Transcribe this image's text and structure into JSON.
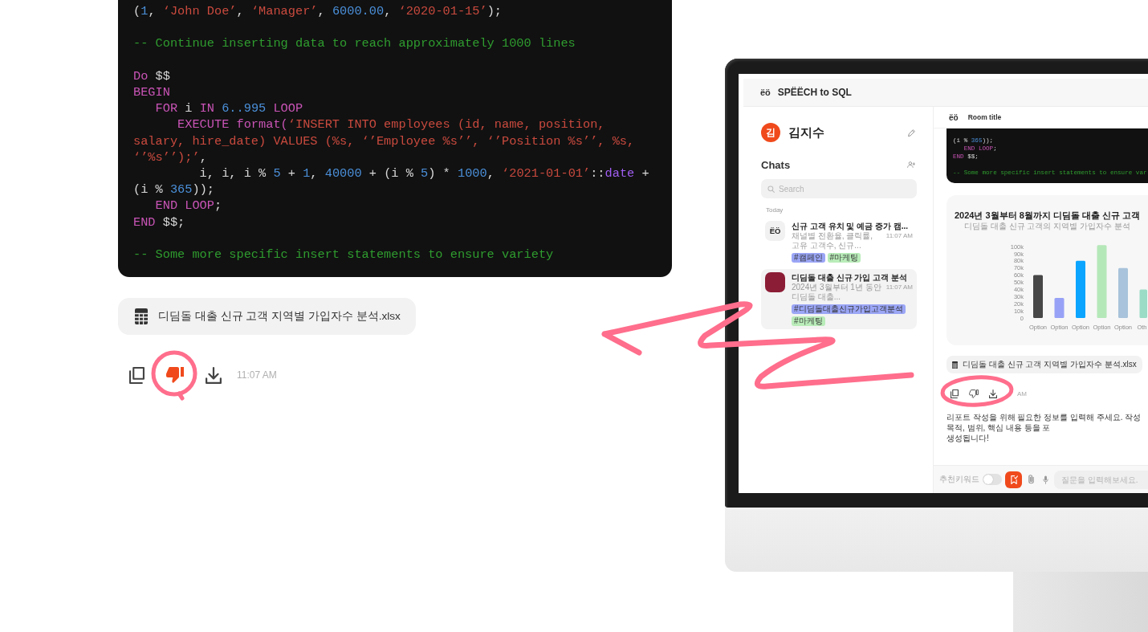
{
  "chat_response": {
    "code_lines": [
      {
        "kind": "code",
        "tokens": [
          {
            "kind": "plain",
            "text": "("
          },
          {
            "kind": "number",
            "text": "1"
          },
          {
            "kind": "plain",
            "text": ", "
          },
          {
            "kind": "string",
            "text": "‘John Doe’"
          },
          {
            "kind": "plain",
            "text": ", "
          },
          {
            "kind": "string",
            "text": "‘Manager’"
          },
          {
            "kind": "plain",
            "text": ", "
          },
          {
            "kind": "number",
            "text": "6000.00"
          },
          {
            "kind": "plain",
            "text": ", "
          },
          {
            "kind": "string",
            "text": "‘2020-01-15’"
          },
          {
            "kind": "plain",
            "text": ");"
          }
        ]
      },
      {
        "kind": "blank"
      },
      {
        "kind": "code",
        "tokens": [
          {
            "kind": "comment",
            "text": "-- Continue inserting data to reach approximately 1000 lines"
          }
        ]
      },
      {
        "kind": "blank"
      },
      {
        "kind": "code",
        "tokens": [
          {
            "kind": "keyword",
            "text": "Do"
          },
          {
            "kind": "plain",
            "text": " $$"
          }
        ]
      },
      {
        "kind": "code",
        "tokens": [
          {
            "kind": "keyword",
            "text": "BEGIN"
          }
        ]
      },
      {
        "kind": "code",
        "tokens": [
          {
            "kind": "keyword",
            "text": "   FOR"
          },
          {
            "kind": "plain",
            "text": " i "
          },
          {
            "kind": "keyword",
            "text": "IN"
          },
          {
            "kind": "number",
            "text": " 6..995"
          },
          {
            "kind": "keyword",
            "text": " LOOP"
          }
        ]
      },
      {
        "kind": "code",
        "tokens": [
          {
            "kind": "keyword",
            "text": "      EXECUTE format("
          },
          {
            "kind": "string",
            "text": "‘INSERT INTO employees (id, name, position,"
          }
        ]
      },
      {
        "kind": "code",
        "tokens": [
          {
            "kind": "string",
            "text": "salary, hire_date) VALUES (%s, ‘’Employee %s’’, ‘’Position %s’’, %s,"
          }
        ]
      },
      {
        "kind": "code",
        "tokens": [
          {
            "kind": "string",
            "text": "‘’%s’’);’"
          },
          {
            "kind": "plain",
            "text": ","
          }
        ]
      },
      {
        "kind": "code",
        "tokens": [
          {
            "kind": "plain",
            "text": "         i, i, i % "
          },
          {
            "kind": "number",
            "text": "5"
          },
          {
            "kind": "plain",
            "text": " + "
          },
          {
            "kind": "number",
            "text": "1"
          },
          {
            "kind": "plain",
            "text": ", "
          },
          {
            "kind": "number",
            "text": "40000"
          },
          {
            "kind": "plain",
            "text": " + (i % "
          },
          {
            "kind": "number",
            "text": "5"
          },
          {
            "kind": "plain",
            "text": ") * "
          },
          {
            "kind": "number",
            "text": "1000"
          },
          {
            "kind": "plain",
            "text": ", "
          },
          {
            "kind": "string",
            "text": "‘2021-01-01’"
          },
          {
            "kind": "plain",
            "text": "::"
          },
          {
            "kind": "type",
            "text": "date"
          },
          {
            "kind": "plain",
            "text": " +"
          }
        ]
      },
      {
        "kind": "code",
        "tokens": [
          {
            "kind": "plain",
            "text": "(i % "
          },
          {
            "kind": "number",
            "text": "365"
          },
          {
            "kind": "plain",
            "text": "));"
          }
        ]
      },
      {
        "kind": "code",
        "tokens": [
          {
            "kind": "keyword",
            "text": "   END LOOP"
          },
          {
            "kind": "plain",
            "text": ";"
          }
        ]
      },
      {
        "kind": "code",
        "tokens": [
          {
            "kind": "keyword",
            "text": "END"
          },
          {
            "kind": "plain",
            "text": " $$;"
          }
        ]
      },
      {
        "kind": "blank"
      },
      {
        "kind": "code",
        "tokens": [
          {
            "kind": "comment",
            "text": "-- Some more specific insert statements to ensure variety"
          }
        ]
      }
    ],
    "attachment": {
      "file_name": "디딤돌 대출 신규 고객 지역별 가입자수 분석.xlsx"
    },
    "actions": {
      "disliked": true,
      "time": "11:07 AM"
    }
  },
  "monitor": {
    "header": {
      "logo": "ëö",
      "title": "SPËËCH to SQL"
    },
    "sidebar": {
      "user": {
        "initial": "김",
        "name": "김지수"
      },
      "chats_heading": "Chats",
      "search": {
        "placeholder": "Search"
      },
      "section_label": "Today",
      "chats": [
        {
          "kind": "logo",
          "logo": "ËÖ",
          "title": "신규 고객 유치 및 예금 증가 캠...",
          "preview": "채널별 전환율, 클릭률, 고유 고객수, 신규...",
          "time": "11:07 AM",
          "selected": false,
          "tags": [
            {
              "text": "#캠페인",
              "color": "#9ba6f6"
            },
            {
              "text": "#마케팅",
              "color": "#b9ecb9"
            }
          ]
        },
        {
          "kind": "photo",
          "title": "디딤돌 대출 신규 가입 고객 분석",
          "preview": "2024년 3월부터 1년 동안 디딤돌 대출...",
          "time": "11:07 AM",
          "selected": true,
          "tags": [
            {
              "text": "#디딤돌대출신규가입고객분석",
              "color": "#9ba6f6"
            },
            {
              "text": "#마케팅",
              "color": "#b9ecb9"
            }
          ]
        }
      ]
    },
    "room": {
      "logo": "ëö",
      "title": "Room title",
      "code_lines": [
        {
          "kind": "code",
          "tokens": [
            {
              "kind": "plain",
              "text": "(i % "
            },
            {
              "kind": "number",
              "text": "365"
            },
            {
              "kind": "plain",
              "text": "));"
            }
          ]
        },
        {
          "kind": "code",
          "tokens": [
            {
              "kind": "keyword",
              "text": "   END LOOP"
            },
            {
              "kind": "plain",
              "text": ";"
            }
          ]
        },
        {
          "kind": "code",
          "tokens": [
            {
              "kind": "keyword",
              "text": "END"
            },
            {
              "kind": "plain",
              "text": " $$;"
            }
          ]
        },
        {
          "kind": "blank"
        },
        {
          "kind": "code",
          "tokens": [
            {
              "kind": "comment",
              "text": "-- Some more specific insert statements to ensure var"
            }
          ]
        }
      ],
      "chart_card": {
        "subtitle": "디딤돌 대출 신규 고객의 지역별 가입자수 분석",
        "chart_data": {
          "type": "bar",
          "title": "2024년 3월부터 8월까지 디딤돌 대출 신규 고객",
          "categories": [
            "Option",
            "Option",
            "Option",
            "Option",
            "Option",
            "Oth"
          ],
          "values": [
            60000,
            28000,
            80000,
            102000,
            70000,
            40000
          ],
          "colors": [
            "#474747",
            "#97a2f6",
            "#0ba5ff",
            "#b5e8b9",
            "#a8c3db",
            "#9bdcc6"
          ],
          "ylim": [
            0,
            105000
          ],
          "yticks": [
            {
              "value": 0,
              "label": "0"
            },
            {
              "value": 10000,
              "label": "10k"
            },
            {
              "value": 20000,
              "label": "20k"
            },
            {
              "value": 30000,
              "label": "30k"
            },
            {
              "value": 40000,
              "label": "40k"
            },
            {
              "value": 50000,
              "label": "50k"
            },
            {
              "value": 60000,
              "label": "60k"
            },
            {
              "value": 70000,
              "label": "70k"
            },
            {
              "value": 80000,
              "label": "80k"
            },
            {
              "value": 90000,
              "label": "90k"
            },
            {
              "value": 100000,
              "label": "100k"
            }
          ]
        }
      },
      "attachment": {
        "file_name": "디딤돌 대출 신규 고객 지역별 가입자수 분석.xlsx"
      },
      "actions": {
        "disliked": false,
        "time": "AM"
      },
      "message_lines": [
        "리포트 작성을 위해 필요한 정보를 입력해 주세요. 작성 목적, 범위, 핵심 내용 등을 포",
        "생성됩니다!"
      ],
      "composer": {
        "keyword_label": "추천키워드",
        "keywords_on": false,
        "placeholder": "질문을 입력해보세요."
      }
    }
  }
}
